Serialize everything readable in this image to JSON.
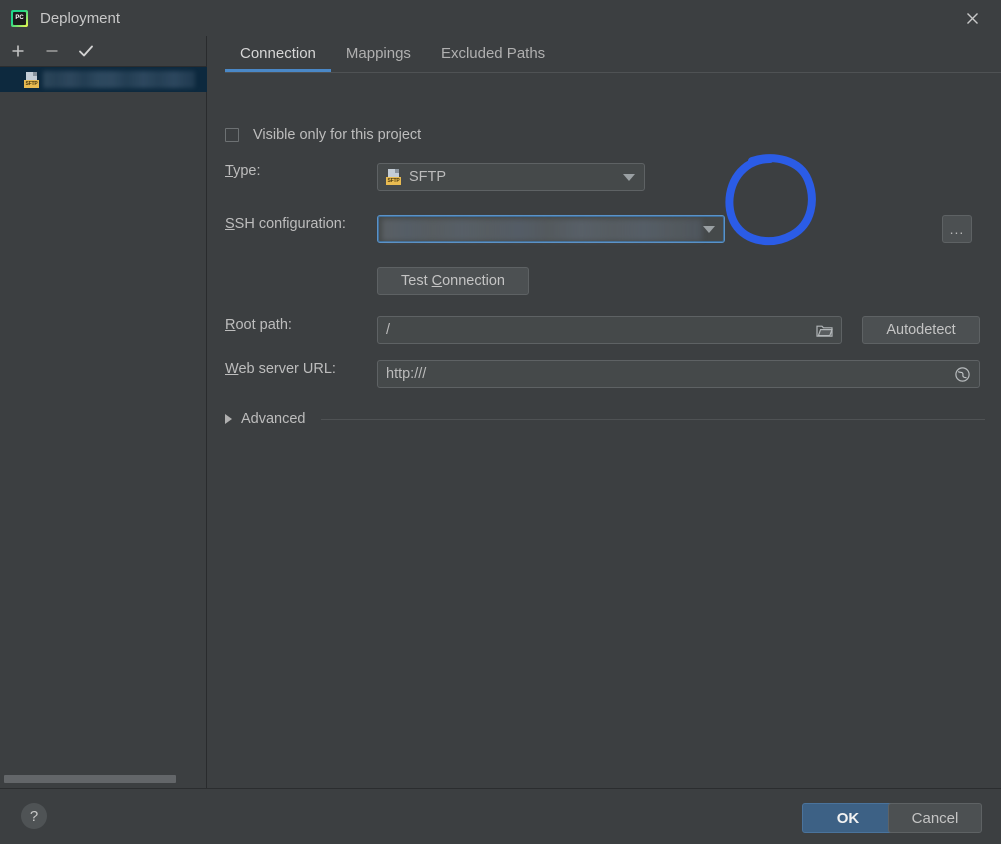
{
  "window": {
    "title": "Deployment",
    "app_icon": "pycharm-icon",
    "close_icon": "close-icon"
  },
  "sidebar": {
    "toolbar": [
      {
        "name": "add-server-button",
        "icon": "plus-icon",
        "label": "+"
      },
      {
        "name": "remove-server-button",
        "icon": "minus-icon",
        "label": "−"
      },
      {
        "name": "set-default-button",
        "icon": "check-icon",
        "label": "✓"
      }
    ],
    "items": [
      {
        "label": "",
        "icon": "sftp-file-icon",
        "badge": "SFTP",
        "selected": true,
        "redacted": true
      }
    ],
    "scrollbar": "horizontal-scrollbar"
  },
  "tabs": [
    {
      "label": "Connection",
      "active": true
    },
    {
      "label": "Mappings",
      "active": false
    },
    {
      "label": "Excluded Paths",
      "active": false
    }
  ],
  "form": {
    "visible_only_checkbox": {
      "label": "Visible only for this project",
      "checked": false
    },
    "type": {
      "label": "Type:",
      "mnemonic": "T",
      "value": "SFTP",
      "icon": "sftp-file-icon",
      "badge": "SFTP",
      "arrow": "chevron-down-icon"
    },
    "ssh_configuration": {
      "label": "SSH configuration:",
      "mnemonic": "S",
      "value": "",
      "redacted": true,
      "focused": true,
      "arrow": "chevron-down-icon",
      "browse_button": "...",
      "browse_icon": "ellipsis-icon"
    },
    "test_connection": {
      "label_before": "Test ",
      "mnemonic": "C",
      "label_after": "onnection"
    },
    "root_path": {
      "label": "Root path:",
      "mnemonic": "R",
      "value": "/",
      "icon": "folder-icon"
    },
    "autodetect": {
      "label": "Autodetect"
    },
    "web_server_url": {
      "label": "Web server URL:",
      "mnemonic": "W",
      "value": "http:///",
      "icon": "globe-icon"
    },
    "advanced": {
      "label": "Advanced",
      "expanded": false,
      "arrow": "triangle-right-icon"
    }
  },
  "bottom": {
    "help_label": "?",
    "ok_label": "OK",
    "cancel_label": "Cancel"
  },
  "annotation": {
    "shape": "hand-drawn-circle",
    "color": "#2b5ce6",
    "target": "ssh-configuration-browse-button"
  },
  "colors": {
    "window_bg": "#3c3f41",
    "field_bg": "#45494a",
    "selection_bg": "#0d293e",
    "tab_accent": "#4a88c7",
    "ok_button": "#3d6185",
    "annotation_blue": "#2b5ce6",
    "sftp_badge": "#e8bb51"
  }
}
